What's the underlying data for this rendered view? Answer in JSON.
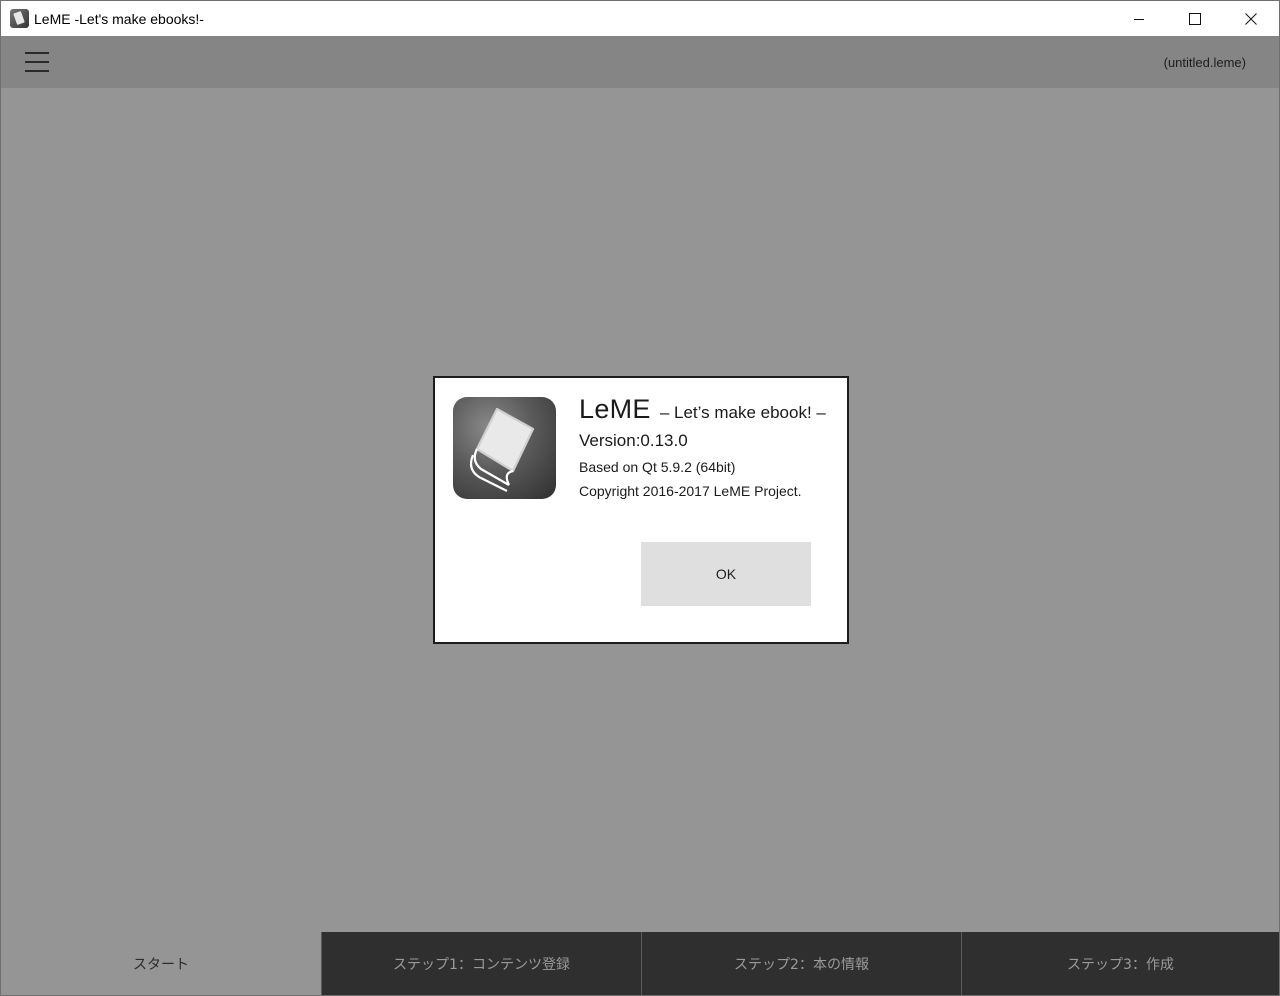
{
  "window": {
    "title": "LeME -Let's make ebooks!-",
    "controls": {
      "minimize": "minimize-icon",
      "maximize": "maximize-icon",
      "close": "close-icon"
    }
  },
  "toolbar": {
    "menu_icon": "hamburger-menu-icon",
    "filename": "(untitled.leme)"
  },
  "dialog": {
    "app_name": "LeME",
    "tagline": "– Let’s make ebook! –",
    "version": "Version:0.13.0",
    "qt_info": "Based on Qt 5.9.2 (64bit)",
    "copyright": "Copyright 2016-2017 LeME Project.",
    "ok_label": "OK",
    "logo_icon": "book-icon"
  },
  "tabs": [
    {
      "label": "スタート",
      "active": true
    },
    {
      "label": "ステップ1：コンテンツ登録",
      "active": false
    },
    {
      "label": "ステップ2：本の情報",
      "active": false
    },
    {
      "label": "ステップ3：作成",
      "active": false
    }
  ],
  "colors": {
    "overlay": "#959595",
    "toolbar": "#858585",
    "tab_inactive": "#2f2f2f",
    "button": "#dfdfdf"
  }
}
